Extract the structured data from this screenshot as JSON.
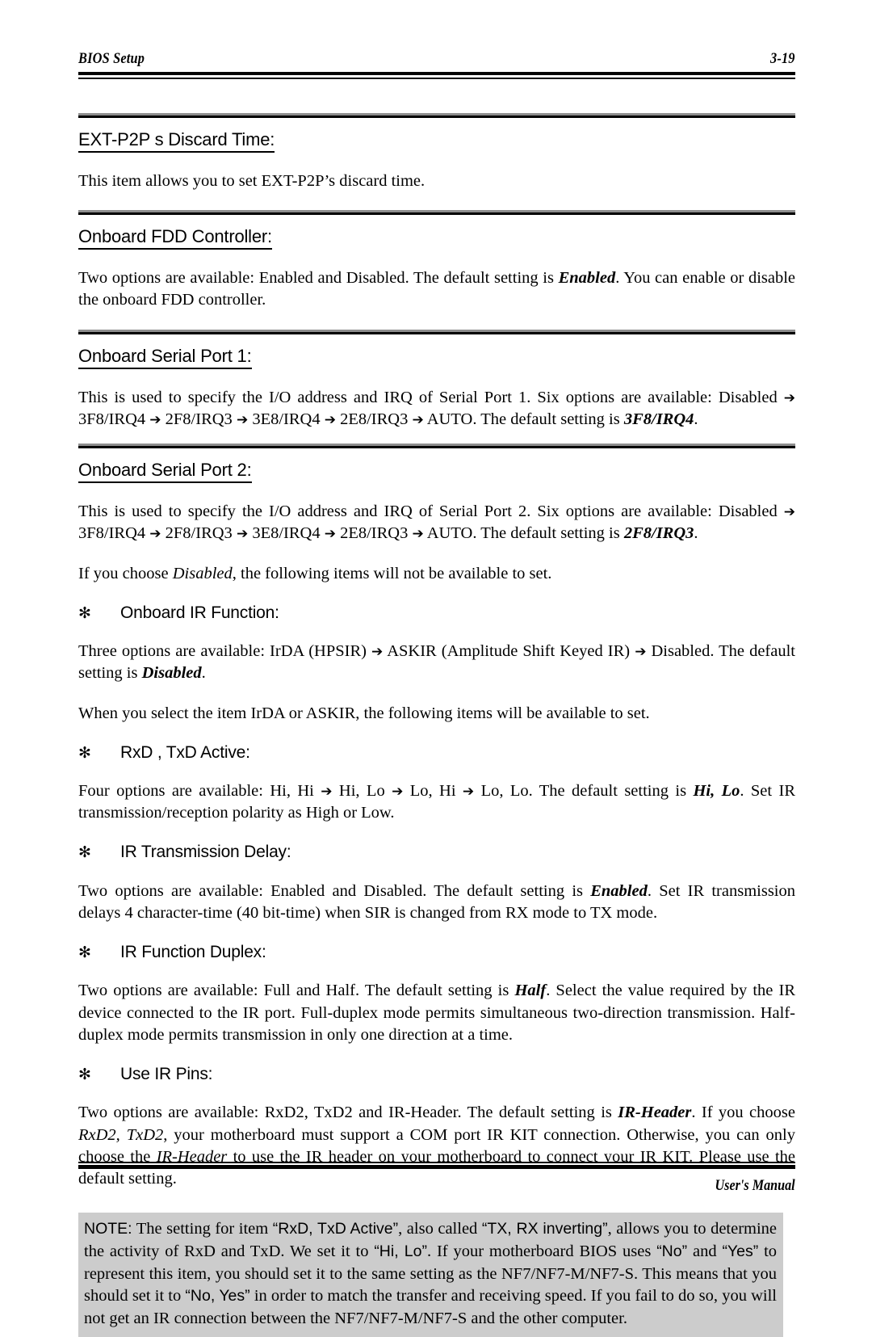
{
  "header": {
    "title": "BIOS Setup",
    "page_number": "3-19"
  },
  "footer": {
    "label": "User's Manual"
  },
  "icons": {
    "bullet": "✻",
    "arrow": "➔"
  },
  "sections": [
    {
      "heading": "EXT-P2P s Discard Time:",
      "paragraphs": [
        "This item allows you to set EXT-P2P’s discard time."
      ]
    },
    {
      "heading": "Onboard FDD Controller:",
      "paragraphs": [
        "Two options are available: Enabled and Disabled. The default setting is Enabled. You can enable or disable the onboard FDD controller."
      ]
    },
    {
      "heading": "Onboard Serial Port 1:",
      "paragraphs": [
        "This is used to specify the I/O address and IRQ of Serial Port 1. Six options are available: Disabled ➔ 3F8/IRQ4 ➔ 2F8/IRQ3 ➔ 3E8/IRQ4 ➔ 2E8/IRQ3 ➔ AUTO. The default setting is 3F8/IRQ4."
      ]
    },
    {
      "heading": "Onboard Serial Port 2:",
      "paragraphs": [
        "This is used to specify the I/O address and IRQ of Serial Port 2. Six options are available: Disabled ➔ 3F8/IRQ4 ➔ 2F8/IRQ3 ➔ 3E8/IRQ4 ➔ 2E8/IRQ3 ➔ AUTO. The default setting is 2F8/IRQ3.",
        "If you choose Disabled, the following items will not be available to set."
      ]
    }
  ],
  "serial1": {
    "intro": "This is used to specify the I/O address and IRQ of Serial Port 1. Six options are available: Disabled",
    "opt1": "3F8/IRQ4",
    "opt2": "2F8/IRQ3",
    "opt3": "3E8/IRQ4",
    "opt4": "2E8/IRQ3",
    "opt5": "AUTO. The default setting is",
    "default": "3F8/IRQ4",
    "period": "."
  },
  "serial2": {
    "intro": "This is used to specify the I/O address and IRQ of Serial Port 2. Six options are available: Disabled",
    "opt1": "3F8/IRQ4",
    "opt2": "2F8/IRQ3",
    "opt3": "3E8/IRQ4",
    "opt4": "2E8/IRQ3",
    "opt5": "AUTO. The default setting is",
    "default": "2F8/IRQ3",
    "period": ".",
    "disabled_note_a": "If you choose",
    "disabled_note_em": "Disabled",
    "disabled_note_b": ", the following items will not be available to set."
  },
  "ext_p2p": {
    "heading": "EXT-P2P s Discard Time:",
    "body": "This item allows you to set EXT-P2P’s discard time."
  },
  "fdd": {
    "heading": "Onboard FDD Controller:",
    "body_a": "Two options are available: Enabled and Disabled. The default setting is",
    "body_em": "Enabled",
    "body_b": ". You can enable or disable the onboard FDD controller."
  },
  "ir_function": {
    "heading": "Onboard IR Function:",
    "body_a": "Three options are available: IrDA (HPSIR)",
    "body_b": "ASKIR (Amplitude Shift Keyed IR)",
    "body_c": "Disabled. The default setting is",
    "body_em": "Disabled",
    "body_d": ".",
    "followup": "When you select the item IrDA or ASKIR, the following items will be available to set."
  },
  "rxd_txd": {
    "heading": "RxD , TxD Active:",
    "body_a": "Four options are available: Hi, Hi",
    "body_b": "Hi, Lo",
    "body_c": "Lo, Hi",
    "body_d": "Lo, Lo. The default setting is",
    "body_em": "Hi, Lo",
    "body_e": ". Set IR transmission/reception polarity as High or Low."
  },
  "ir_delay": {
    "heading": "IR Transmission Delay:",
    "body_a": "Two options are available: Enabled and Disabled. The default setting is",
    "body_em": "Enabled",
    "body_b": ". Set IR transmission delays 4 character-time (40 bit-time) when SIR is changed from RX mode to TX mode."
  },
  "ir_duplex": {
    "heading": "IR Function Duplex:",
    "body_a": "Two options are available: Full and Half. The default setting is",
    "body_em": "Half",
    "body_b": ". Select the value required by the IR device connected to the IR port. Full-duplex mode permits simultaneous two-direction transmission. Half-duplex mode permits transmission in only one direction at a time."
  },
  "use_ir_pins": {
    "heading": "Use IR Pins:",
    "body_a": "Two options are available: RxD2, TxD2 and IR-Header. The default setting is",
    "body_em1": "IR-Header",
    "body_b": ". If you choose",
    "body_em2": "RxD2, TxD2",
    "body_c": ", your motherboard must support a COM port IR KIT connection. Otherwise, you can only choose the",
    "body_em3": "IR-Header",
    "body_d": "to use the IR header on your motherboard to connect your IR KIT. Please use the default setting."
  },
  "note": {
    "label": "NOTE:",
    "t1": "The setting for item",
    "q1": "“RxD, TxD Active”",
    "t2": ", also called",
    "q2": "“TX, RX inverting”",
    "t3": ", allows you to determine the activity of RxD and TxD. We set it to",
    "q3": "“Hi, Lo”",
    "t4": ". If your motherboard BIOS uses",
    "q4": "“No”",
    "t5": "and",
    "q5": "“Yes”",
    "t6": "to represent this item, you should set it to the same setting as the NF7/NF7-M/NF7-S. This means that you should set it to",
    "q6": "“No, Yes”",
    "t7": "in order to match the transfer and receiving speed. If you fail to do so, you will not get an IR connection between the NF7/NF7-M/NF7-S and the other computer."
  }
}
